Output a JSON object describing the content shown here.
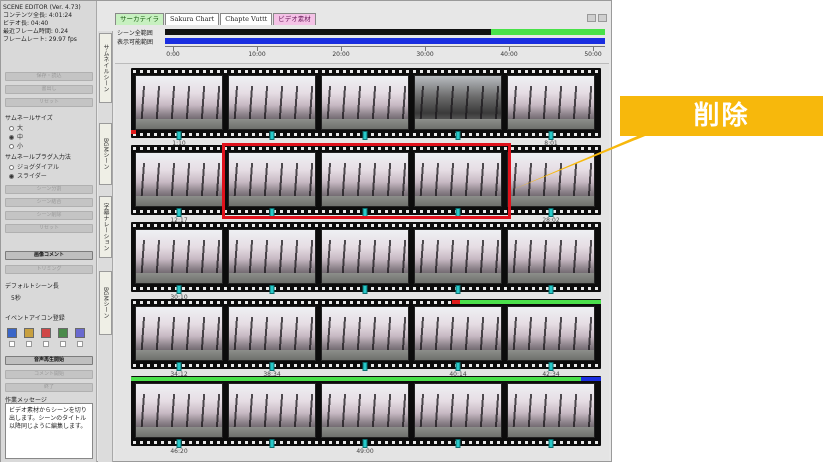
{
  "app": {
    "info_lines": [
      "SCENE EDITOR (Ver. 4.73)",
      "コンテンツ全長: 4:01:24",
      "ビデオ長: 04:40",
      "最近フレーム時間: 0.24",
      "フレームレート: 29.97 fps"
    ]
  },
  "top_tabs": [
    {
      "label": "サーカテイラ"
    },
    {
      "label": "Sakura Chart"
    },
    {
      "label": "Chapte Vuttt"
    },
    {
      "label": "ビデオ素材"
    }
  ],
  "bars": {
    "scene_label": "シーン全範囲",
    "display_label": "表示可能範囲",
    "scene_fill_fraction": 0.74
  },
  "ruler": {
    "labels": [
      "0:00",
      "10:00",
      "20:00",
      "30:00",
      "40:00",
      "50:00"
    ]
  },
  "left_panel": {
    "buttons_top": [
      "保存・読込",
      "書出し",
      "リセット"
    ],
    "thumb_size_label": "サムネールサイズ",
    "thumb_sizes": [
      "大",
      "中",
      "小"
    ],
    "thumb_size_selected": 1,
    "thumb_mode_label": "サムネールプラグ入力法",
    "thumb_modes": [
      "ジョグダイアル",
      "スライダー"
    ],
    "thumb_mode_selected": 1,
    "disabled_buttons": [
      "シーン分割",
      "シーン結合",
      "シーン削除",
      "リセット"
    ],
    "active_button_1": "画像コメント",
    "disabled_button_2": "トリミング",
    "default_scene_label": "デフォルトシーン長",
    "default_scene_value": "5秒",
    "icon_label": "イベントアイコン登録",
    "icon_colors": [
      "#3a66c8",
      "#c8a040",
      "#d04848",
      "#4a8a4a",
      "#6a6ad0"
    ],
    "active_button_2": "音声再生開始",
    "disabled_buttons_2": [
      "コメント開始",
      "終了"
    ],
    "msg_label": "作業メッセージ",
    "msg_text": "ビデオ素材からシーンを切り出します。シーンのタイトル以降同じように編集します。"
  },
  "vertical_tabs": [
    {
      "label": "サムネイルシーン"
    },
    {
      "label": "BGMシーン"
    },
    {
      "label": "字幕ナレーション"
    },
    {
      "label": "BGMシーン"
    }
  ],
  "film_rows": [
    {
      "frames": 5,
      "labels": [
        "1:10",
        "",
        "",
        "",
        "8:01"
      ]
    },
    {
      "frames": 5,
      "labels": [
        "12:17",
        "",
        "",
        "",
        "28:02"
      ]
    },
    {
      "frames": 5,
      "labels": [
        "30:10",
        "",
        "",
        "",
        ""
      ]
    },
    {
      "frames": 5,
      "labels": [
        "34:12",
        "38:34",
        "",
        "40:14",
        "42:34"
      ]
    },
    {
      "frames": 5,
      "labels": [
        "46:20",
        "",
        "49:00",
        "",
        ""
      ]
    }
  ],
  "callout": {
    "text": "削除",
    "color": "#f7b80c"
  },
  "highlight_color": "#e0111b"
}
